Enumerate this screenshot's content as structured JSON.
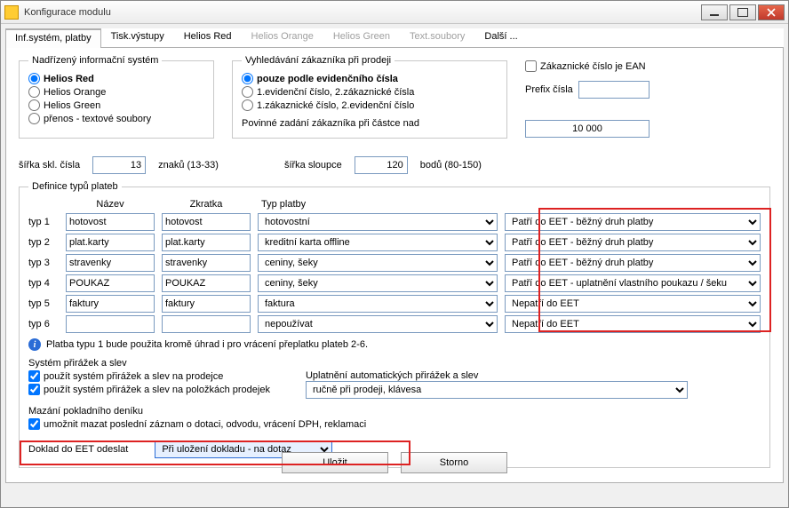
{
  "window": {
    "title": "Konfigurace modulu"
  },
  "tabs": {
    "0": {
      "label": "Inf.systém, platby"
    },
    "1": {
      "label": "Tisk.výstupy"
    },
    "2": {
      "label": "Helios Red"
    },
    "3": {
      "label": "Helios Orange"
    },
    "4": {
      "label": "Helios Green"
    },
    "5": {
      "label": "Text.soubory"
    },
    "6": {
      "label": "Další ..."
    }
  },
  "supervisor_system": {
    "legend": "Nadřízený informační systém",
    "helios_red": "Helios Red",
    "helios_orange": "Helios Orange",
    "helios_green": "Helios Green",
    "prenos": "přenos - textové soubory"
  },
  "customer_search": {
    "legend": "Vyhledávání zákazníka při prodeji",
    "opt1": "pouze podle evidenčního čísla",
    "opt2": "1.evidenční číslo, 2.zákaznické čísla",
    "opt3": "1.zákaznické číslo, 2.evidenční číslo",
    "mandatory_label": "Povinné zadání zákazníka při částce nad"
  },
  "customer_number": {
    "ean_label": "Zákaznické číslo je EAN",
    "prefix_label": "Prefix čísla",
    "prefix_value": "",
    "mandatory_value": "10 000"
  },
  "width_row": {
    "skl_label": "šířka skl. čísla",
    "skl_value": "13",
    "skl_suffix": "znaků (13-33)",
    "col_label": "šířka sloupce",
    "col_value": "120",
    "col_suffix": "bodů (80-150)"
  },
  "payments": {
    "legend": "Definice typů plateb",
    "hdr_nazev": "Název",
    "hdr_zkr": "Zkratka",
    "hdr_typ": "Typ platby",
    "typ1_label": "typ 1",
    "typ1_nazev": "hotovost",
    "typ1_zkr": "hotovost",
    "typ1_typ": "hotovostní",
    "typ1_eet": "Patří do EET - běžný druh platby",
    "typ2_label": "typ 2",
    "typ2_nazev": "plat.karty",
    "typ2_zkr": "plat.karty",
    "typ2_typ": "kreditní karta offline",
    "typ2_eet": "Patří do EET - běžný druh platby",
    "typ3_label": "typ 3",
    "typ3_nazev": "stravenky",
    "typ3_zkr": "stravenky",
    "typ3_typ": "ceniny, šeky",
    "typ3_eet": "Patří do EET - běžný druh platby",
    "typ4_label": "typ 4",
    "typ4_nazev": "POUKAZ",
    "typ4_zkr": "POUKAZ",
    "typ4_typ": "ceniny, šeky",
    "typ4_eet": "Patří do EET - uplatnění vlastního poukazu / šeku",
    "typ5_label": "typ 5",
    "typ5_nazev": "faktury",
    "typ5_zkr": "faktury",
    "typ5_typ": "faktura",
    "typ5_eet": "Nepatří do EET",
    "typ6_label": "typ 6",
    "typ6_nazev": "",
    "typ6_zkr": "",
    "typ6_typ": "nepoužívat",
    "typ6_eet": "Nepatří do EET",
    "note": "Platba typu 1 bude použita kromě úhrad i pro vrácení přeplatku plateb 2-6.",
    "surcharge_title": "Systém přirážek a slev",
    "surcharge_seller": "použít systém přirážek a slev na prodejce",
    "surcharge_items": "použít systém přirážek a slev na položkách prodejek",
    "surcharge_auto_label": "Uplatnění automatických přirážek a slev",
    "surcharge_auto_value": "ručně při prodeji, klávesa",
    "journal_title": "Mazání pokladního deníku",
    "journal_check": "umožnit mazat poslední záznam o dotaci, odvodu, vrácení DPH, reklamaci",
    "eet_send_label": "Doklad do EET odeslat",
    "eet_send_value": "Při uložení dokladu - na dotaz"
  },
  "buttons": {
    "save": "Uložit",
    "cancel": "Storno"
  }
}
